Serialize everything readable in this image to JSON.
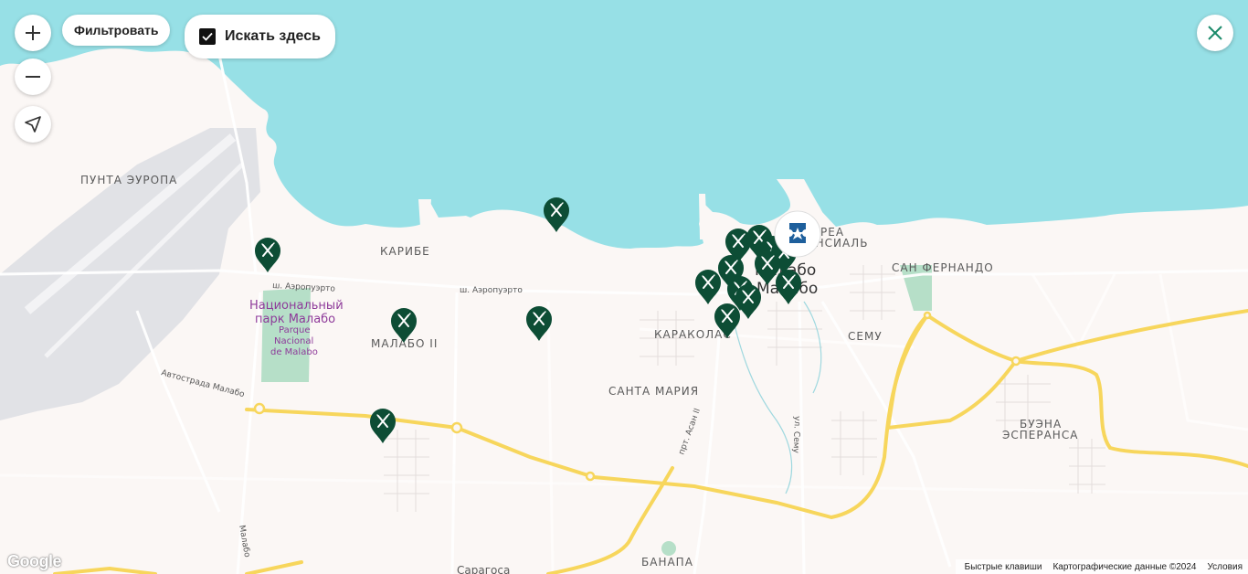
{
  "controls": {
    "filter_label": "Фильтровать",
    "search_here_label": "Искать здесь",
    "search_here_checked": true
  },
  "map": {
    "labels": {
      "punta_europa": "ПУНТА ЭУРОПА",
      "karibe": "КАРИБЕ",
      "malabo_ii": "МАЛАБО II",
      "karakolas": "КАРАКОЛАС",
      "santa_maria": "САНТА МАРИЯ",
      "semu": "СЕМУ",
      "san_fernando": "САН ФЕРНАНДО",
      "buena_esperansa_1": "БУЭНА",
      "buena_esperansa_2": "ЭСПЕРАНСА",
      "banapa": "БАНАПА",
      "saragosa": "Сарагоса",
      "area_1": "РЕА",
      "area_2": "ЕНСИАЛЬ",
      "city_1": "Малабо",
      "city_2": "Малабо",
      "park_1": "Национальный",
      "park_2": "парк Малабо",
      "park_sub_1": "Parque",
      "park_sub_2": "Nacional",
      "park_sub_3": "de Malabo"
    },
    "roads": {
      "aeropuerto_1": "ш. Аэропуэрто",
      "aeropuerto_2": "ш. Аэропуэрто",
      "autostrada": "Автострада Малабо",
      "malabo": "Малабо",
      "asan": "прт. Асан II",
      "semu": "ул. Сему"
    },
    "colors": {
      "water": "#97e0e6",
      "land": "#fbf7f5",
      "park": "#b6dfc8",
      "highway": "#f7d65c",
      "marker": "#0d4d35",
      "airport": "#e1e2e6"
    },
    "restaurant_marker_count": 18,
    "attraction_marker_icon": "ticket-star-icon"
  },
  "attribution": {
    "google": "Google",
    "shortcuts": "Быстрые клавиши",
    "map_data": "Картографические данные ©2024",
    "terms": "Условия"
  }
}
